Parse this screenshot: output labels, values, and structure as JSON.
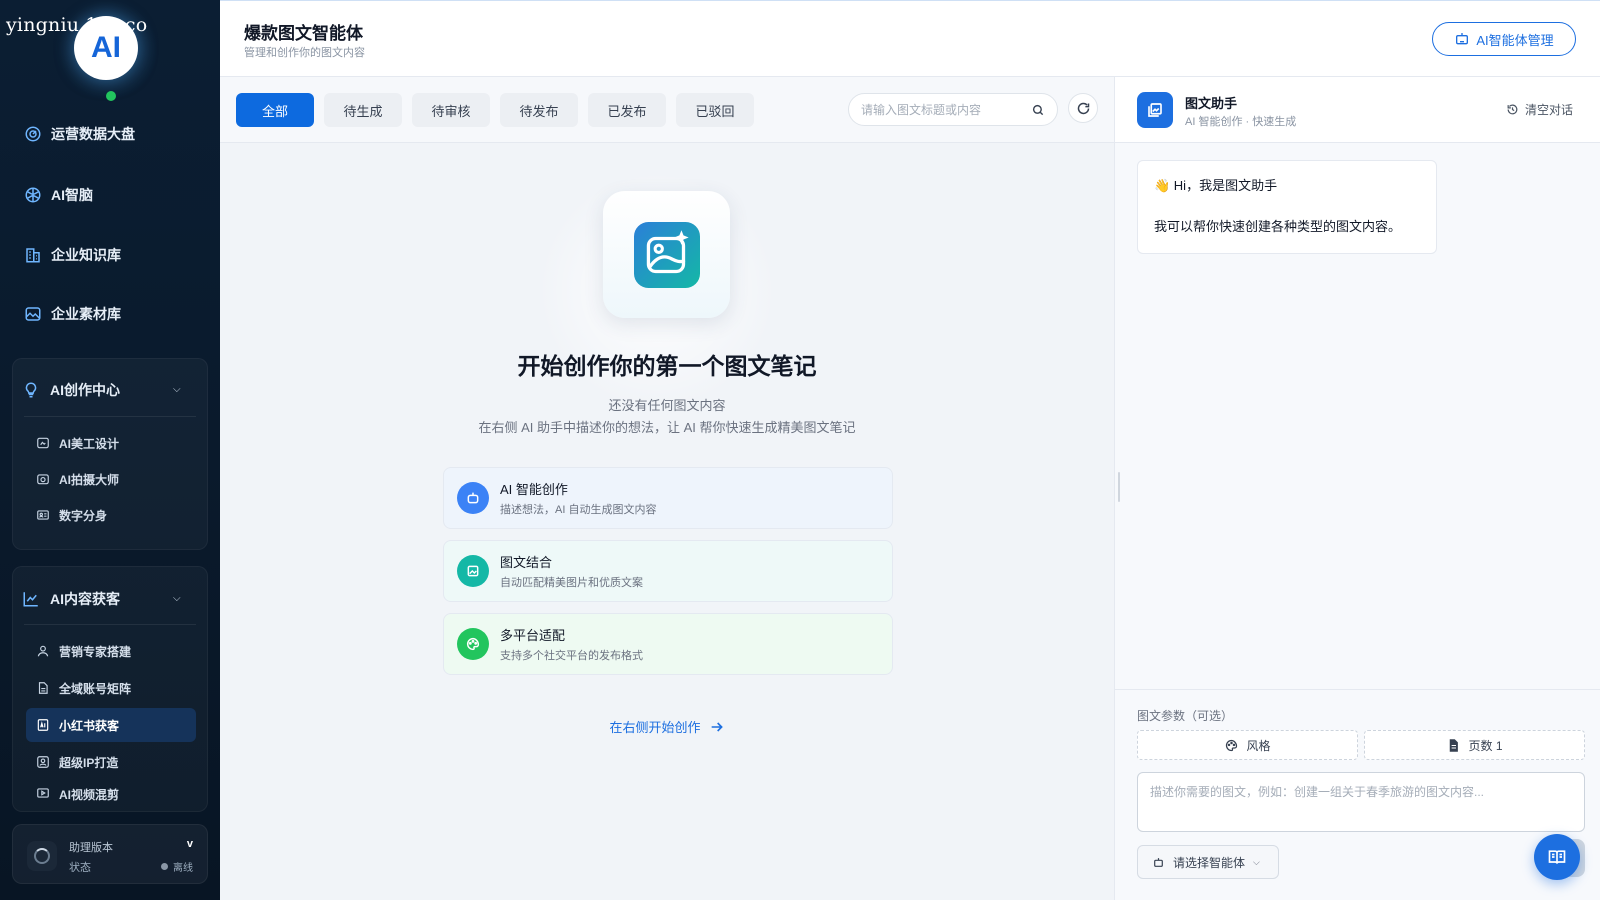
{
  "watermark": "yingniu.10v.co",
  "logo_text": "AI",
  "sidebar": {
    "items": [
      {
        "label": "运营数据大盘",
        "icon": "dashboard-icon"
      },
      {
        "label": "AI智脑",
        "icon": "brain-icon"
      },
      {
        "label": "企业知识库",
        "icon": "building-icon"
      },
      {
        "label": "企业素材库",
        "icon": "image-icon"
      }
    ],
    "groups": [
      {
        "label": "AI创作中心",
        "icon": "lightbulb-icon",
        "items": [
          {
            "label": "AI美工设计",
            "icon": "design-icon"
          },
          {
            "label": "AI拍摄大师",
            "icon": "camera-icon"
          },
          {
            "label": "数字分身",
            "icon": "avatar-card-icon"
          }
        ]
      },
      {
        "label": "AI内容获客",
        "icon": "trend-chart-icon",
        "items": [
          {
            "label": "营销专家搭建",
            "icon": "user-icon"
          },
          {
            "label": "全域账号矩阵",
            "icon": "document-icon"
          },
          {
            "label": "小红书获客",
            "icon": "ai-doc-icon",
            "active": true
          },
          {
            "label": "超级IP打造",
            "icon": "id-badge-icon"
          },
          {
            "label": "AI视频混剪",
            "icon": "video-icon"
          }
        ]
      }
    ],
    "footer": {
      "version_label": "助理版本",
      "version_value": "v",
      "status_label": "状态",
      "status_value": "离线"
    }
  },
  "header": {
    "title": "爆款图文智能体",
    "subtitle": "管理和创作你的图文内容",
    "manage_button": "AI智能体管理"
  },
  "toolbar": {
    "tabs": [
      {
        "label": "全部",
        "active": true
      },
      {
        "label": "待生成"
      },
      {
        "label": "待审核"
      },
      {
        "label": "待发布"
      },
      {
        "label": "已发布"
      },
      {
        "label": "已驳回"
      }
    ],
    "search_placeholder": "请输入图文标题或内容"
  },
  "empty_state": {
    "title": "开始创作你的第一个图文笔记",
    "line1": "还没有任何图文内容",
    "line2": "在右侧 AI 助手中描述你的想法，让 AI 帮你快速生成精美图文笔记",
    "features": [
      {
        "title": "AI 智能创作",
        "desc": "描述想法，AI 自动生成图文内容",
        "color": "#3b82f6",
        "bg": "#eef4fc"
      },
      {
        "title": "图文结合",
        "desc": "自动匹配精美图片和优质文案",
        "color": "#14b8a6",
        "bg": "#eef9f8"
      },
      {
        "title": "多平台适配",
        "desc": "支持多个社交平台的发布格式",
        "color": "#22c55e",
        "bg": "#eefaf2"
      }
    ],
    "cta": "在右侧开始创作"
  },
  "chat": {
    "name": "图文助手",
    "subtitle": "AI 智能创作 · 快速生成",
    "clear_label": "清空对话",
    "greeting": "👋 Hi，我是图文助手",
    "message": "我可以帮你快速创建各种类型的图文内容。",
    "params_label": "图文参数（可选）",
    "style_label": "风格",
    "pages_label": "页数 1",
    "prompt_placeholder": "描述你需要的图文，例如：创建一组关于春季旅游的图文内容...",
    "agent_select": "请选择智能体"
  }
}
